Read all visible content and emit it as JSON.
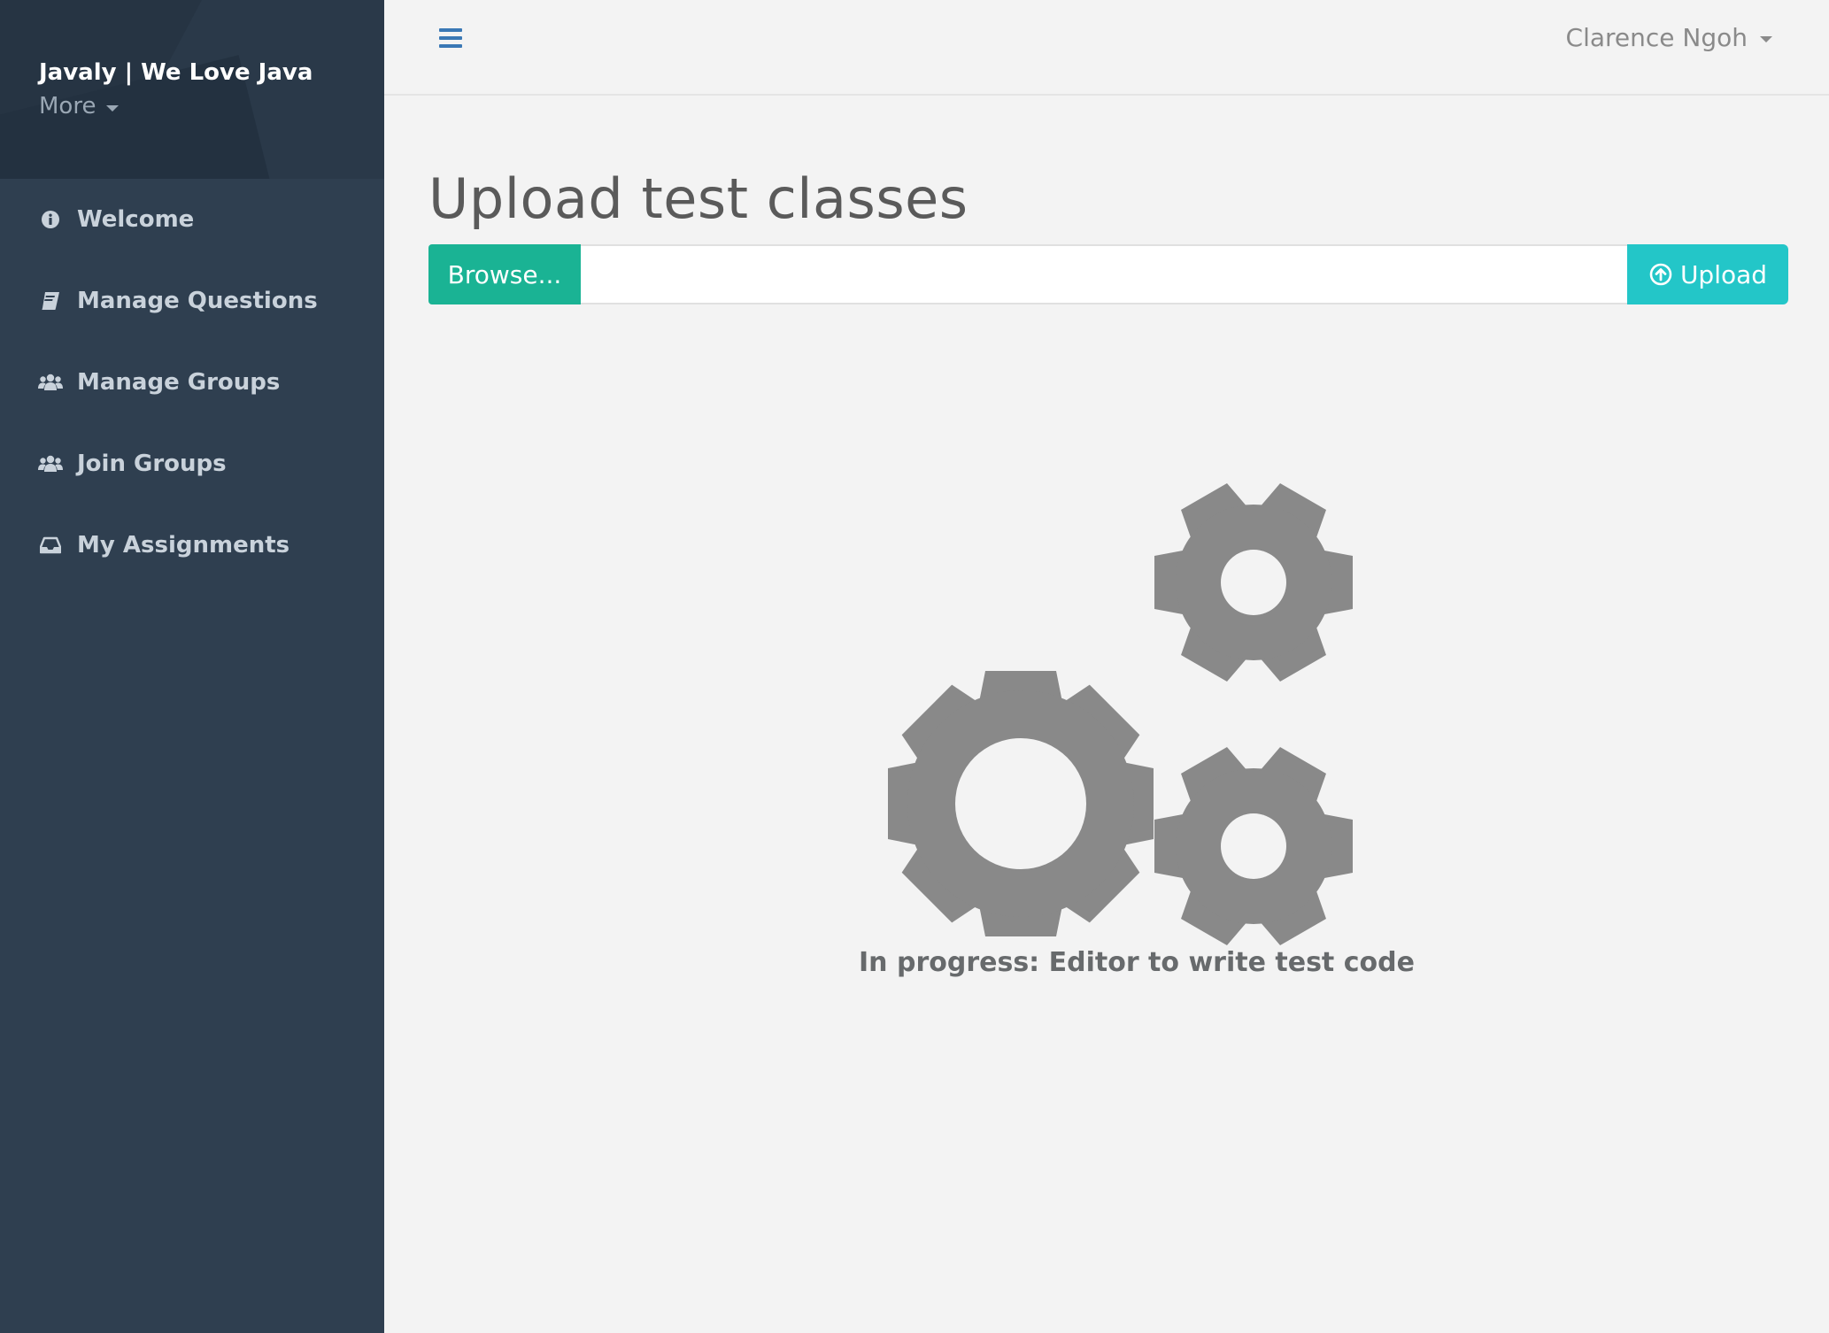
{
  "app": {
    "brand_title": "Javaly | We Love Java",
    "brand_more": "More"
  },
  "sidebar": {
    "items": [
      {
        "label": "Welcome",
        "icon": "info-circle-icon"
      },
      {
        "label": "Manage Questions",
        "icon": "book-icon"
      },
      {
        "label": "Manage Groups",
        "icon": "users-icon"
      },
      {
        "label": "Join Groups",
        "icon": "users-icon"
      },
      {
        "label": "My Assignments",
        "icon": "inbox-icon"
      }
    ]
  },
  "topbar": {
    "menu_icon": "hamburger-icon",
    "user_name": "Clarence Ngoh"
  },
  "main": {
    "title": "Upload test classes",
    "browse_label": "Browse...",
    "file_value": "",
    "upload_label": "Upload",
    "upload_icon": "arrow-circle-up-icon",
    "illustration_icon": "gears-icon",
    "progress_message": "In progress: Editor to write test code"
  },
  "colors": {
    "sidebar_bg": "#2f3f50",
    "brand_bg": "#263443",
    "browse_green": "#1ab394",
    "upload_cyan": "#23c6c8",
    "gear_gray": "#898989",
    "hamburger_blue": "#3a78b5"
  }
}
